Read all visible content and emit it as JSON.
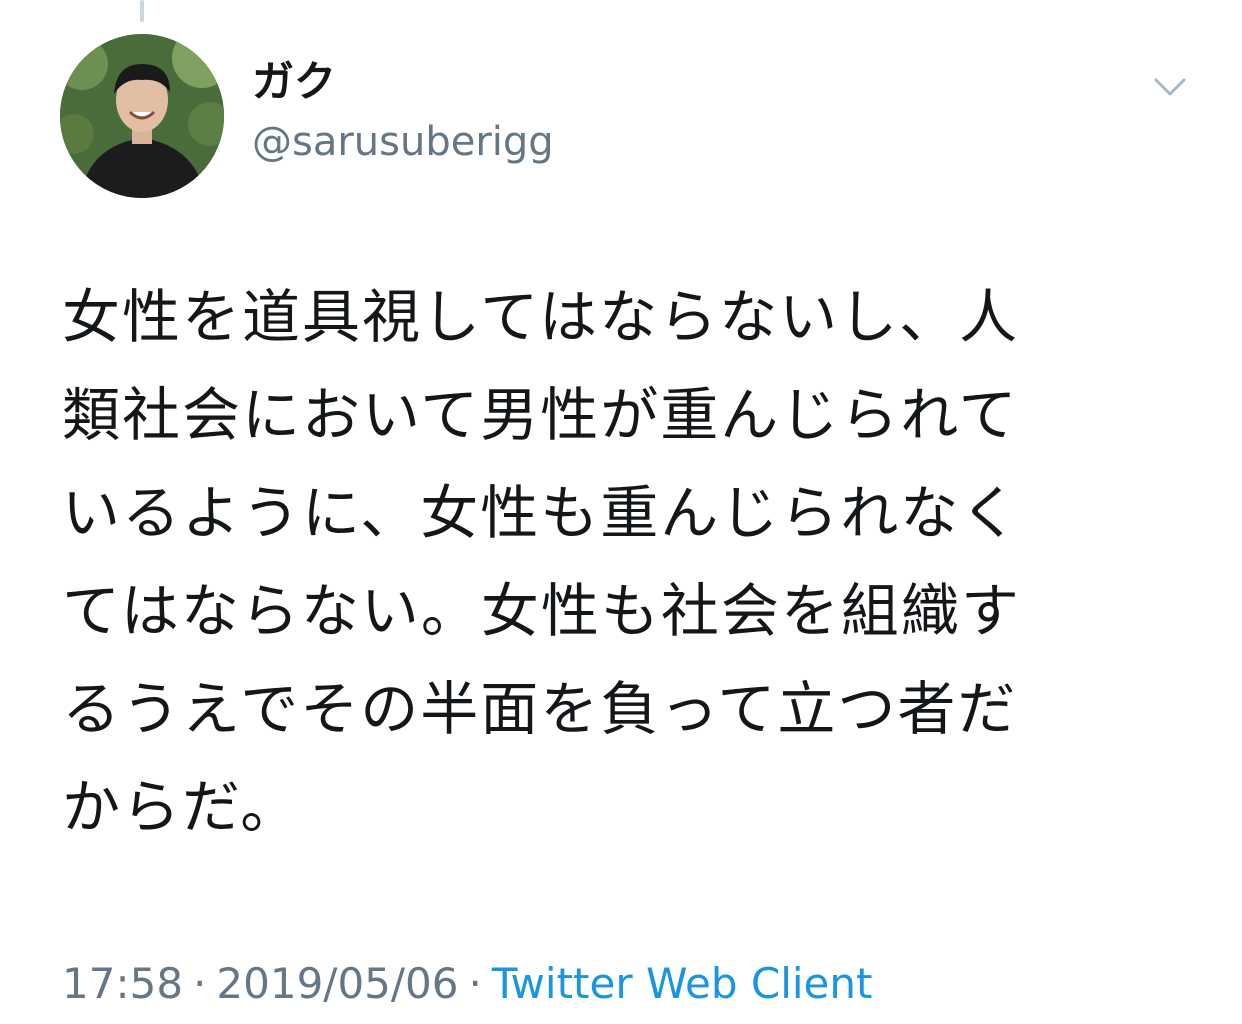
{
  "user": {
    "display_name": "ガク",
    "handle": "@sarusuberigg"
  },
  "tweet": {
    "lines": [
      "女性を道具視してはならないし、人",
      "類社会において男性が重んじられて",
      "いるように、女性も重んじられなく",
      "てはならない。女性も社会を組織す",
      "るうえでその半面を負って立つ者だ",
      "からだ。"
    ]
  },
  "meta": {
    "time": "17:58",
    "separator": "·",
    "date": "2019/05/06",
    "client": "Twitter Web Client"
  },
  "icons": {
    "menu": "chevron-down-icon"
  },
  "colors": {
    "text": "#14171a",
    "secondary": "#657786",
    "link": "#1b95e0",
    "thread_line": "#ccd6dd"
  }
}
